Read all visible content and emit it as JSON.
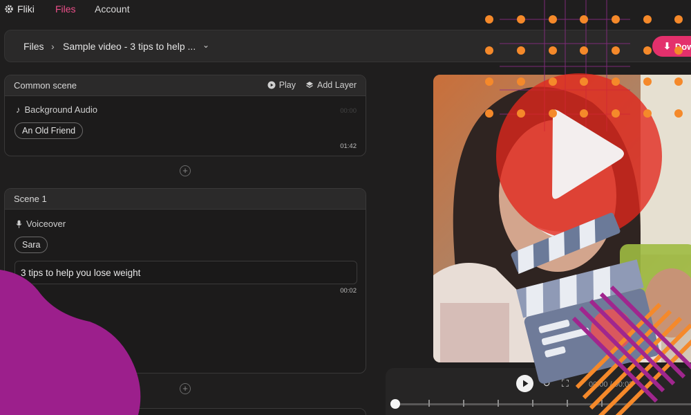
{
  "nav": {
    "brand": "Fliki",
    "files": "Files",
    "account": "Account"
  },
  "breadcrumb": {
    "root": "Files",
    "separator": "›",
    "title": "Sample video - 3 tips to help ...",
    "caret": "⌄"
  },
  "download": {
    "label": "Dow"
  },
  "common_scene": {
    "title": "Common scene",
    "play_label": "Play",
    "add_layer_label": "Add Layer",
    "audio_label": "Background Audio",
    "audio_track": "An Old Friend",
    "duration": "01:42",
    "faint_time": "00:00"
  },
  "scene1": {
    "title": "Scene 1",
    "voiceover_label": "Voiceover",
    "voice": "Sara",
    "text": "3 tips to help you lose weight",
    "duration": "00:02"
  },
  "player": {
    "timecode": "00:00 / 00:02"
  },
  "colors": {
    "accent": "#e3306c",
    "nav_active": "#ec4f8a",
    "deco_purple": "#9c1f8c",
    "deco_orange": "#f5892a",
    "play_red": "#e1261c"
  }
}
